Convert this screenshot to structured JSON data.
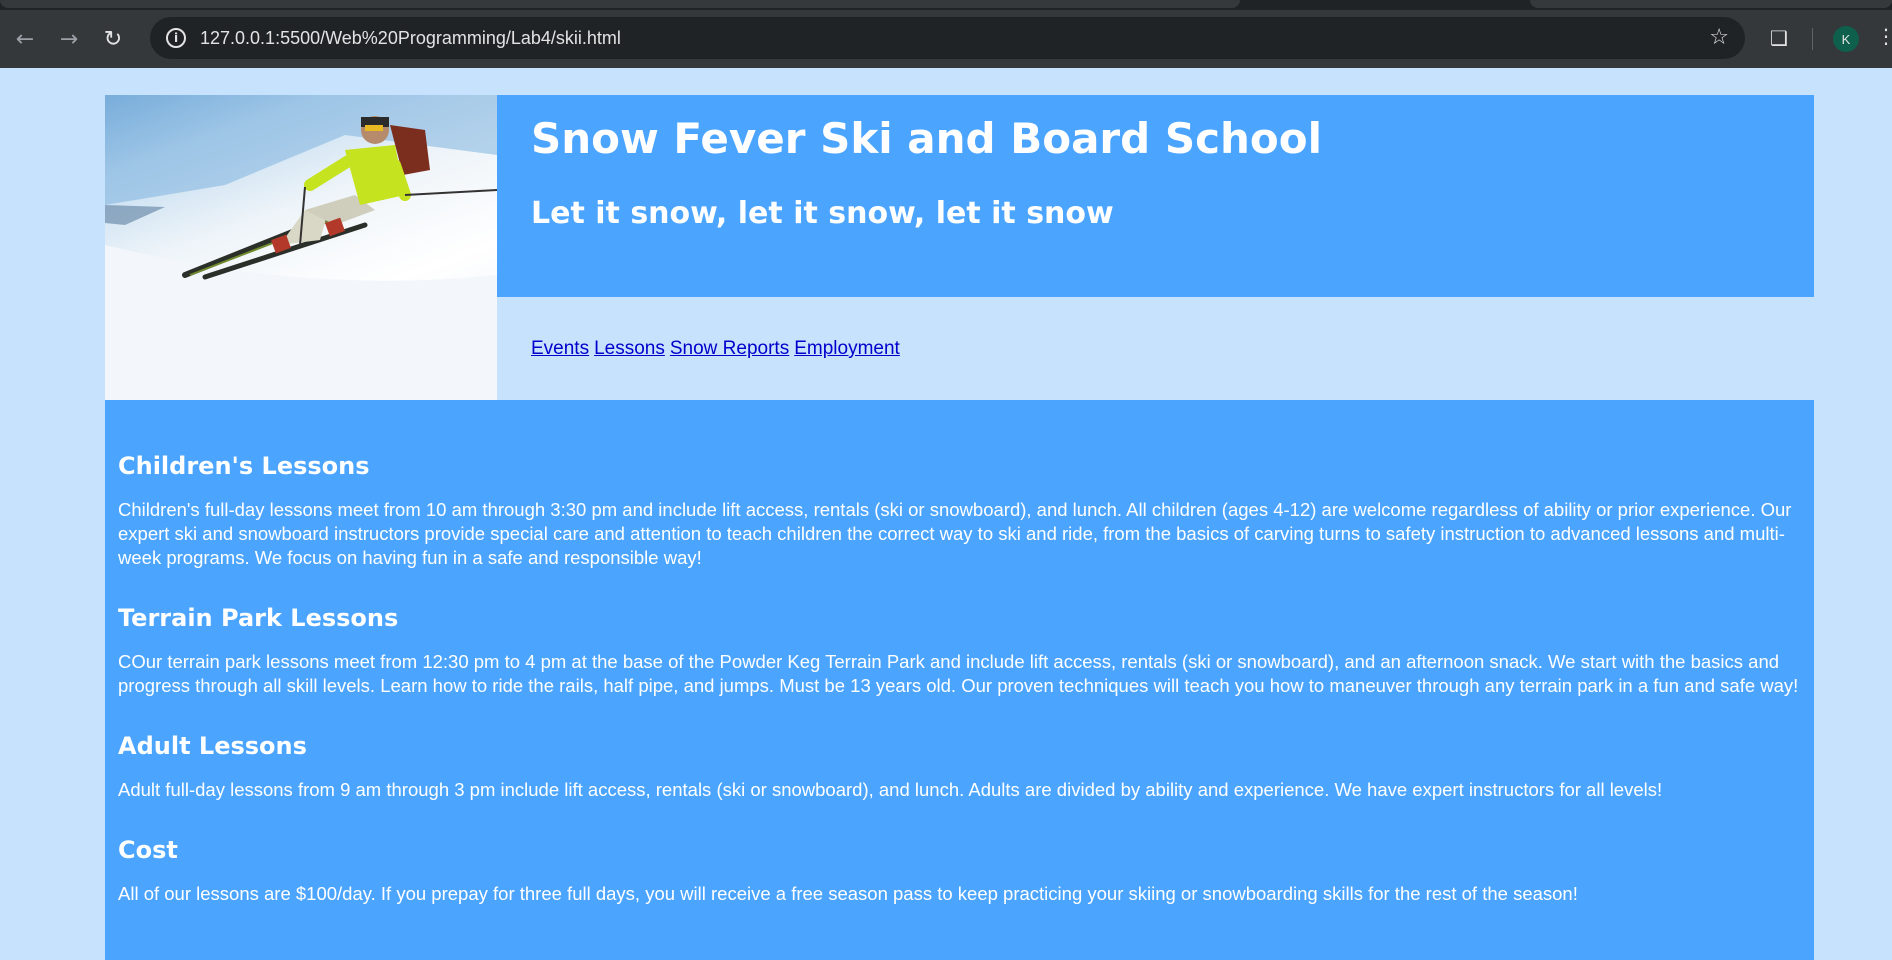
{
  "browser": {
    "url": "127.0.0.1:5500/Web%20Programming/Lab4/skii.html",
    "back_icon": "arrow-left-icon",
    "forward_icon": "arrow-right-icon",
    "reload_icon": "reload-icon",
    "profile_initial": "K"
  },
  "header": {
    "title": "Snow Fever Ski and Board School",
    "subtitle": "Let it snow, let it snow, let it snow"
  },
  "nav": {
    "links": [
      "Events",
      "Lessons",
      "Snow Reports",
      "Employment"
    ]
  },
  "sections": [
    {
      "heading": "Children's Lessons",
      "text": "Children's full-day lessons meet from 10 am through 3:30 pm and include lift access, rentals (ski or snowboard), and lunch. All children (ages 4-12) are welcome regardless of ability or prior experience. Our expert ski and snowboard instructors provide special care and attention to teach children the correct way to ski and ride, from the basics of carving turns to safety instruction to advanced lessons and multi-week programs. We focus on having fun in a safe and responsible way!"
    },
    {
      "heading": "Terrain Park Lessons",
      "text": "COur terrain park lessons meet from 12:30 pm to 4 pm at the base of the Powder Keg Terrain Park and include lift access, rentals (ski or snowboard), and an afternoon snack. We start with the basics and progress through all skill levels. Learn how to ride the rails, half pipe, and jumps. Must be 13 years old. Our proven techniques will teach you how to maneuver through any terrain park in a fun and safe way!"
    },
    {
      "heading": "Adult Lessons",
      "text": "Adult full-day lessons from 9 am through 3 pm include lift access, rentals (ski or snowboard), and lunch. Adults are divided by ability and experience. We have expert instructors for all levels!"
    },
    {
      "heading": "Cost",
      "text": "All of our lessons are $100/day. If you prepay for three full days, you will receive a free season pass to keep practicing your skiing or snowboarding skills for the rest of the season!"
    }
  ],
  "colors": {
    "page_bg": "#c7e2fc",
    "accent": "#4ba5ff",
    "link": "#0000cc"
  }
}
